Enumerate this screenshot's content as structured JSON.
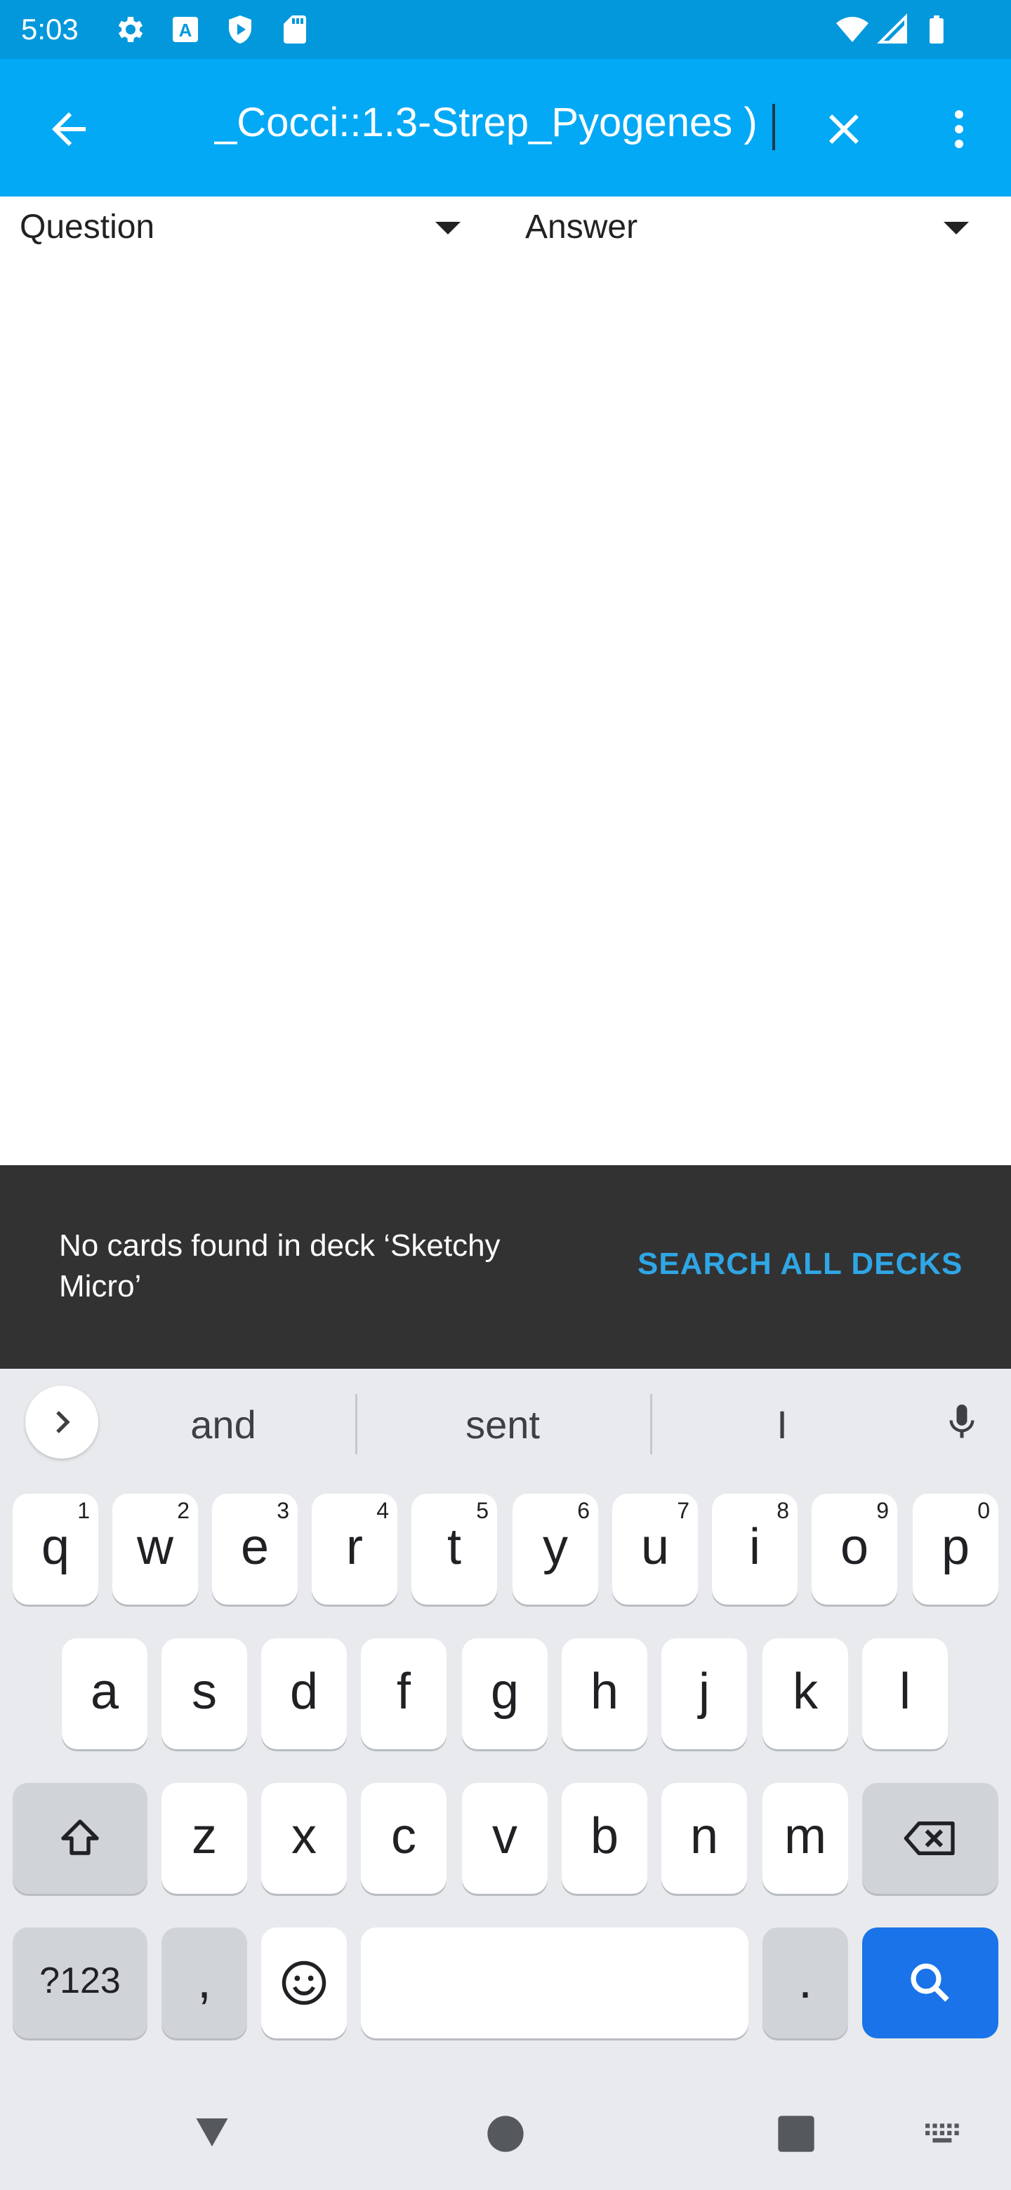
{
  "status_bar": {
    "time": "5:03"
  },
  "app_bar": {
    "search_query": "_Cocci::1.3-Strep_Pyogenes )"
  },
  "columns": {
    "question_label": "Question",
    "answer_label": "Answer"
  },
  "snackbar": {
    "message": "No cards found in deck ‘Sketchy Micro’",
    "action_label": "SEARCH ALL DECKS"
  },
  "keyboard": {
    "suggestions": [
      "and",
      "sent",
      "I"
    ],
    "row1": [
      {
        "key": "q",
        "hint": "1"
      },
      {
        "key": "w",
        "hint": "2"
      },
      {
        "key": "e",
        "hint": "3"
      },
      {
        "key": "r",
        "hint": "4"
      },
      {
        "key": "t",
        "hint": "5"
      },
      {
        "key": "y",
        "hint": "6"
      },
      {
        "key": "u",
        "hint": "7"
      },
      {
        "key": "i",
        "hint": "8"
      },
      {
        "key": "o",
        "hint": "9"
      },
      {
        "key": "p",
        "hint": "0"
      }
    ],
    "row2": [
      "a",
      "s",
      "d",
      "f",
      "g",
      "h",
      "j",
      "k",
      "l"
    ],
    "row3": [
      "z",
      "x",
      "c",
      "v",
      "b",
      "n",
      "m"
    ],
    "symbols_label": "?123",
    "comma_label": ",",
    "period_label": "."
  },
  "colors": {
    "status_bar": "#0398DB",
    "app_bar": "#03A9F4",
    "snackbar_bg": "#323232",
    "snackbar_action": "#2FA6E5",
    "keyboard_bg": "#E8EAED",
    "search_key": "#1A73E8"
  }
}
